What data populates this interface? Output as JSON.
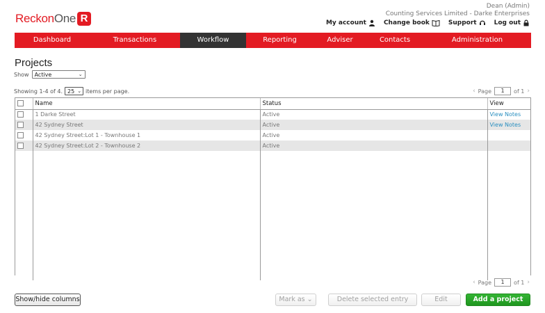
{
  "header": {
    "logo_part1": "Reckon",
    "logo_part2": "One",
    "logo_badge": "R",
    "user_name": "Dean (Admin)",
    "company": "Counting Services Limited - Darke Enterprises",
    "links": [
      {
        "label": "My account",
        "icon": "user-icon"
      },
      {
        "label": "Change book",
        "icon": "book-icon"
      },
      {
        "label": "Support",
        "icon": "headset-icon"
      },
      {
        "label": "Log out",
        "icon": "lock-icon"
      }
    ]
  },
  "nav": {
    "items": [
      "Dashboard",
      "Transactions",
      "Workflow",
      "Reporting",
      "Adviser",
      "Contacts",
      "Administration"
    ],
    "active": "Workflow",
    "color": "#e31b23",
    "active_color": "#333333"
  },
  "page": {
    "title": "Projects",
    "show_label": "Show",
    "show_value": "Active",
    "showing_prefix": "Showing 1-4 of 4.",
    "per_page_value": "25",
    "per_page_suffix": "items per page."
  },
  "pager": {
    "page_label": "Page",
    "page_value": "1",
    "of_label": "of 1"
  },
  "table": {
    "columns": [
      "Name",
      "Status",
      "View"
    ],
    "rows": [
      {
        "name": "1 Darke Street",
        "status": "Active",
        "view": "View Notes"
      },
      {
        "name": "42 Sydney Street",
        "status": "Active",
        "view": "View Notes"
      },
      {
        "name": "42 Sydney Street:Lot 1 - Townhouse 1",
        "status": "Active",
        "view": ""
      },
      {
        "name": "42 Sydney Street:Lot 2 - Townhouse 2",
        "status": "Active",
        "view": ""
      }
    ]
  },
  "footer": {
    "show_hide": "Show/hide columns",
    "mark_as": "Mark as",
    "delete": "Delete selected entry",
    "edit": "Edit",
    "add": "Add a project"
  }
}
